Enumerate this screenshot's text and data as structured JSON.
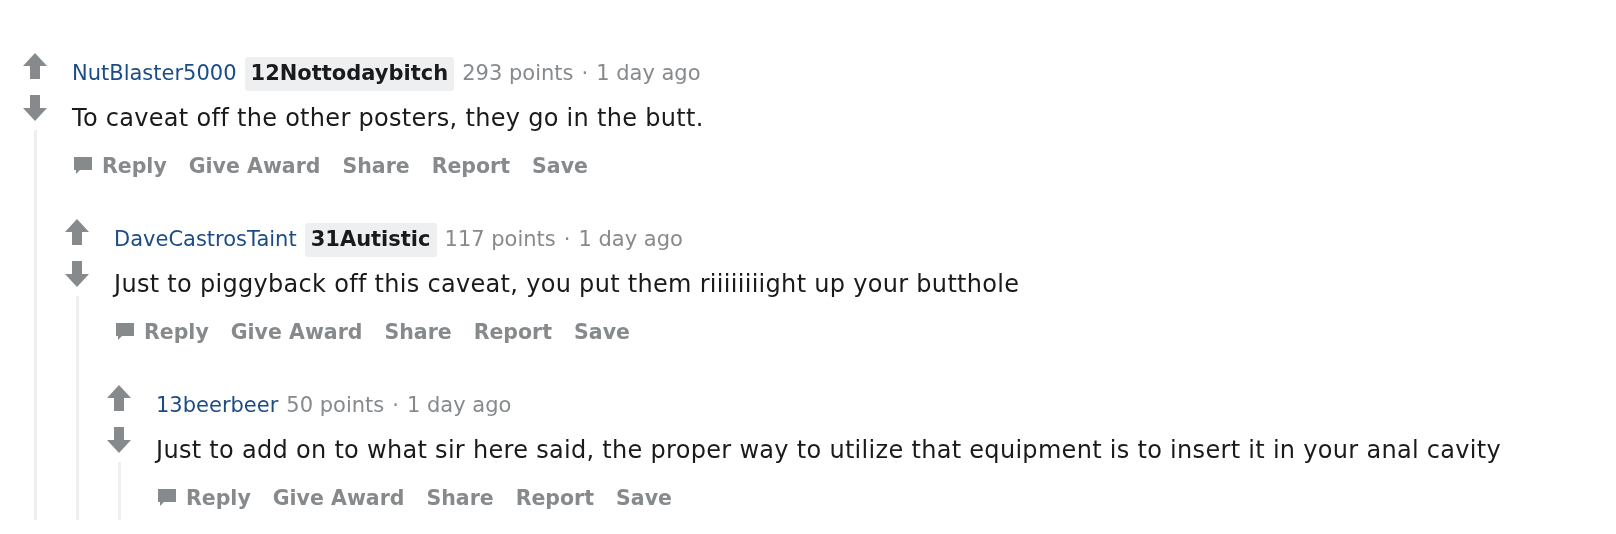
{
  "comments": [
    {
      "author": "NutBlaster5000",
      "flair": "12Nottodaybitch",
      "points": "293 points",
      "separator": "·",
      "time": "1 day ago",
      "body": "To caveat off the other posters, they go in the butt.",
      "actions": [
        {
          "label": "Reply",
          "kind": "reply"
        },
        {
          "label": "Give Award",
          "kind": "text"
        },
        {
          "label": "Share",
          "kind": "text"
        },
        {
          "label": "Report",
          "kind": "text"
        },
        {
          "label": "Save",
          "kind": "text"
        }
      ],
      "children": [
        {
          "author": "DaveCastrosTaint",
          "flair": "31Autistic",
          "points": "117 points",
          "separator": "·",
          "time": "1 day ago",
          "body": "Just to piggyback off this caveat, you put them riiiiiiiight up your butthole",
          "actions": [
            {
              "label": "Reply",
              "kind": "reply"
            },
            {
              "label": "Give Award",
              "kind": "text"
            },
            {
              "label": "Share",
              "kind": "text"
            },
            {
              "label": "Report",
              "kind": "text"
            },
            {
              "label": "Save",
              "kind": "text"
            }
          ],
          "children": [
            {
              "author": "13beerbeer",
              "points": "50 points",
              "separator": "·",
              "time": "1 day ago",
              "body": "Just to add on to what sir here said, the proper way to utilize that equipment is to insert it in your anal cavity",
              "actions": [
                {
                  "label": "Reply",
                  "kind": "reply"
                },
                {
                  "label": "Give Award",
                  "kind": "text"
                },
                {
                  "label": "Share",
                  "kind": "text"
                },
                {
                  "label": "Report",
                  "kind": "text"
                },
                {
                  "label": "Save",
                  "kind": "text"
                }
              ]
            }
          ]
        }
      ]
    }
  ]
}
